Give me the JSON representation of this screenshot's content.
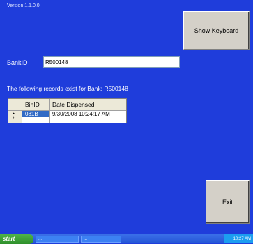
{
  "version": "Version 1.1.0.0",
  "toolbar": {
    "keyboard_label": "Show Keyboard",
    "exit_label": "Exit"
  },
  "bank": {
    "label": "BankID",
    "value": "R500148"
  },
  "records": {
    "message": "The following records exist for Bank: R500148",
    "columns": [
      "BinID",
      "Date Dispensed"
    ],
    "rows": [
      {
        "bin_id": "081B",
        "date": "9/30/2008 10:24:17 AM"
      }
    ]
  },
  "taskbar": {
    "start_label": "start",
    "items": [
      "...",
      "..."
    ],
    "clock": "10:27 AM"
  }
}
